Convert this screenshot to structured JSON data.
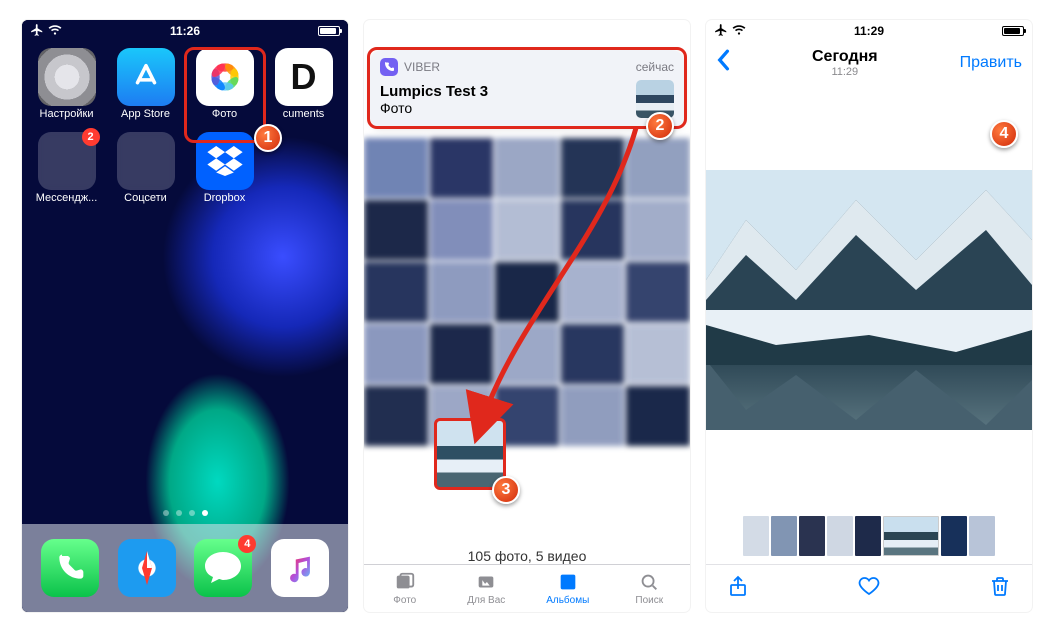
{
  "phone1": {
    "status": {
      "time": "11:26"
    },
    "apps": [
      {
        "label": "Настройки",
        "name": "app-settings"
      },
      {
        "label": "App Store",
        "name": "app-appstore"
      },
      {
        "label": "Фото",
        "name": "app-photos"
      },
      {
        "label": "Documents",
        "name": "app-documents",
        "visibleLabel": "cuments"
      }
    ],
    "folders": [
      {
        "label": "Мессендж...",
        "badge": "2"
      },
      {
        "label": "Соцсети"
      },
      {
        "label": "Dropbox"
      }
    ],
    "dock_badge": "4"
  },
  "phone2": {
    "notif": {
      "app": "VIBER",
      "time": "сейчас",
      "title": "Lumpics Test 3",
      "subtitle": "Фото"
    },
    "footer": "105 фото, 5 видео",
    "tabs": [
      {
        "label": "Фото",
        "name": "tab-photos"
      },
      {
        "label": "Для Вас",
        "name": "tab-foryou"
      },
      {
        "label": "Альбомы",
        "name": "tab-albums",
        "active": true
      },
      {
        "label": "Поиск",
        "name": "tab-search"
      }
    ]
  },
  "phone3": {
    "status": {
      "time": "11:29"
    },
    "nav": {
      "title": "Сегодня",
      "subtitle": "11:29",
      "edit": "Править"
    }
  },
  "callouts": {
    "c1": "1",
    "c2": "2",
    "c3": "3",
    "c4": "4"
  },
  "colors": {
    "accent": "#007aff",
    "highlight": "#e0281c",
    "viber": "#7360f2"
  }
}
